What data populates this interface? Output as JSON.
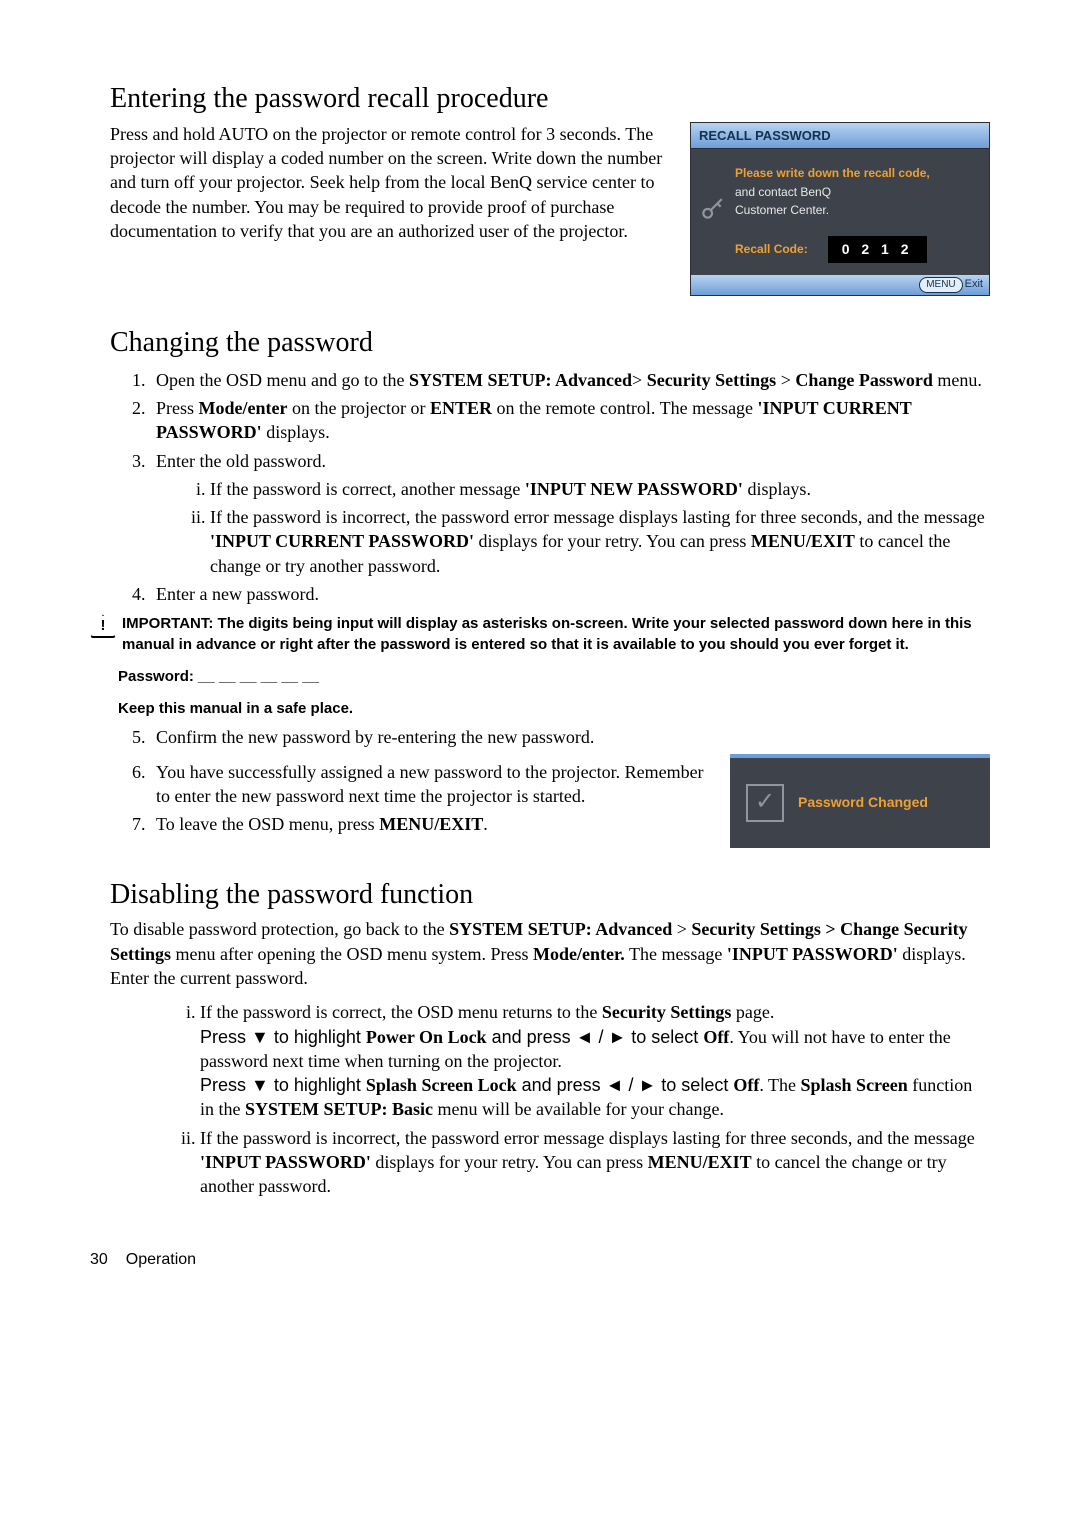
{
  "section1": {
    "heading": "Entering the password recall procedure",
    "intro": "Press and hold AUTO on the projector or remote control for 3 seconds. The projector will display a coded number on the screen. Write down the number and turn off your projector. Seek help from the local BenQ service center to decode the number. You may be required to provide proof of purchase documentation to verify that you are an authorized user of the projector.",
    "panel": {
      "title": "RECALL PASSWORD",
      "msg_line1": "Please write down the recall code,",
      "msg_line2": "and contact BenQ",
      "msg_line3": "Customer Center.",
      "code_label": "Recall Code:",
      "code_value": "0 2 1 2",
      "footer_menu": "MENU",
      "footer_exit": "Exit"
    }
  },
  "section2": {
    "heading": "Changing the password",
    "steps": {
      "s1a": "Open the OSD menu and go to the ",
      "s1b": "SYSTEM SETUP: Advanced",
      "s1c": "> ",
      "s1d": "Security Settings",
      "s1e": " > ",
      "s1f": "Change Password",
      "s1g": " menu.",
      "s2a": "Press ",
      "s2b": "Mode/enter",
      "s2c": " on the projector or ",
      "s2d": "ENTER",
      "s2e": " on the remote control. The message ",
      "s2f": "'INPUT CURRENT PASSWORD'",
      "s2g": " displays.",
      "s3": "Enter the old password.",
      "s3i_a": "If the password is correct, another message ",
      "s3i_b": "'INPUT NEW PASSWORD'",
      "s3i_c": " displays.",
      "s3ii_a": "If the password is incorrect, the password error message displays lasting for three seconds, and the message ",
      "s3ii_b": "'INPUT CURRENT PASSWORD'",
      "s3ii_c": " displays for your retry. You can press ",
      "s3ii_d": "MENU/EXIT",
      "s3ii_e": " to cancel the change or try another password.",
      "s4": "Enter a new password."
    },
    "important": "IMPORTANT: The digits being input will display as asterisks on-screen. Write your selected password down here in this manual in advance or right after the password is entered so that it is available to you should you ever forget it.",
    "password_line": "Password: __ __ __ __ __ __",
    "keep_line": "Keep this manual in a safe place.",
    "steps2": {
      "s5": "Confirm the new password by re-entering the new password.",
      "s6": "You have successfully assigned a new password to the projector. Remember to enter the new password next time the projector is started.",
      "s7a": "To leave the OSD menu, press ",
      "s7b": "MENU/EXIT",
      "s7c": "."
    },
    "changed_label": "Password Changed"
  },
  "section3": {
    "heading": "Disabling the password function",
    "intro_a": "To disable password protection, go back to the ",
    "intro_b": "SYSTEM SETUP: Advanced",
    "intro_c": " > ",
    "intro_d": "Security Settings > Change Security Settings",
    "intro_e": " menu after opening the OSD menu system. Press ",
    "intro_f": "Mode/enter.",
    "intro_g": " The message ",
    "intro_h": "'INPUT PASSWORD'",
    "intro_i": " displays. Enter the current password.",
    "i_a": "If the password is correct, the OSD menu returns to the ",
    "i_b": "Security Settings",
    "i_c": " page.",
    "i_p2a": "Press ▼ to highlight ",
    "i_p2b": "Power On Lock",
    "i_p2c": " and press ◄ / ►  to select ",
    "i_p2d": "Off",
    "i_p2e": ". You will not have to enter the password next time when turning on the projector.",
    "i_p3a": "Press ▼ to highlight ",
    "i_p3b": "Splash Screen Lock",
    "i_p3c": " and press ◄ / ►  to select ",
    "i_p3d": "Off",
    "i_p3e": ". The ",
    "i_p3f": "Splash Screen",
    "i_p3g": " function in the ",
    "i_p3h": "SYSTEM SETUP: Basic",
    "i_p3i": " menu will be available for your change.",
    "ii_a": "If the password is incorrect, the password error message displays lasting for three seconds, and the message ",
    "ii_b": "'INPUT PASSWORD'",
    "ii_c": " displays for your retry. You can press ",
    "ii_d": "MENU/EXIT",
    "ii_e": " to cancel the change or try another password."
  },
  "footer": {
    "page_number": "30",
    "section_name": "Operation"
  }
}
